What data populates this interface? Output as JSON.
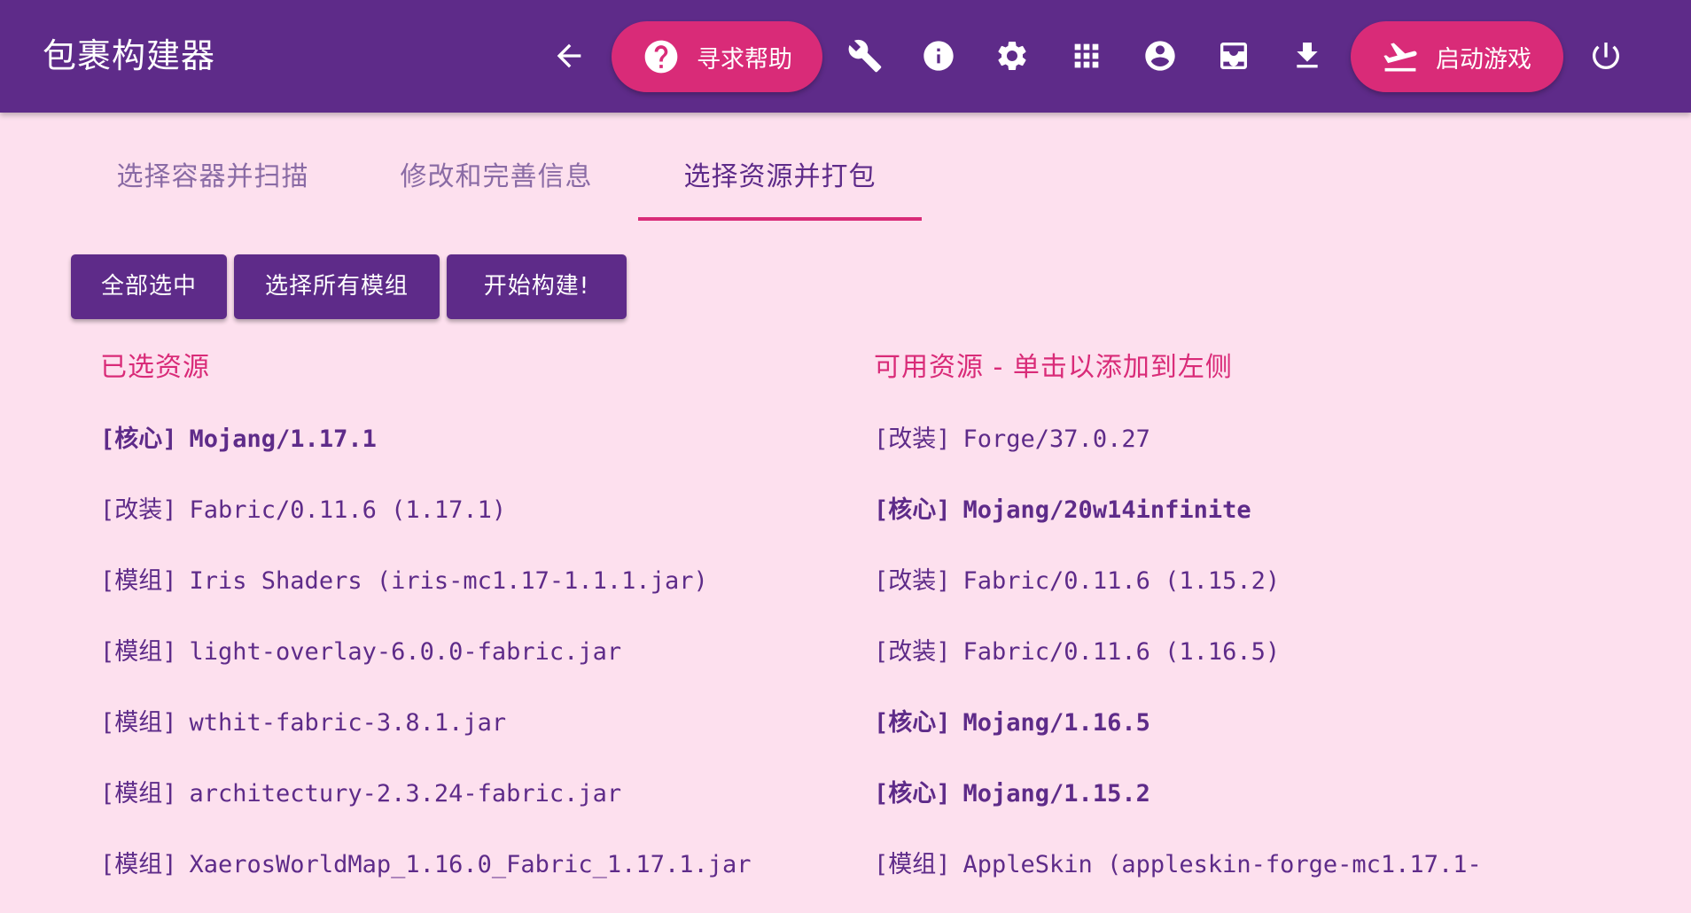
{
  "app": {
    "title": "包裹构建器"
  },
  "toolbar": {
    "help_label": "寻求帮助",
    "launch_label": "启动游戏",
    "icons": [
      "back-arrow-icon",
      "help-icon",
      "wrench-icon",
      "info-icon",
      "settings-gear-icon",
      "apps-grid-icon",
      "account-icon",
      "inbox-tray-icon",
      "download-icon",
      "airplane-takeoff-icon",
      "power-icon"
    ]
  },
  "tabs": [
    {
      "label": "选择容器并扫描",
      "active": false
    },
    {
      "label": "修改和完善信息",
      "active": false
    },
    {
      "label": "选择资源并打包",
      "active": true
    }
  ],
  "actions": {
    "select_all": "全部选中",
    "select_all_mods": "选择所有模组",
    "start_build": "开始构建!"
  },
  "selected": {
    "header": "已选资源",
    "items": [
      {
        "tag": "[核心]",
        "name": "Mojang/1.17.1",
        "bold": true
      },
      {
        "tag": "[改装]",
        "name": "Fabric/0.11.6 (1.17.1)",
        "bold": false
      },
      {
        "tag": "[模组]",
        "name": "Iris Shaders (iris-mc1.17-1.1.1.jar)",
        "bold": false
      },
      {
        "tag": "[模组]",
        "name": "light-overlay-6.0.0-fabric.jar",
        "bold": false
      },
      {
        "tag": "[模组]",
        "name": "wthit-fabric-3.8.1.jar",
        "bold": false
      },
      {
        "tag": "[模组]",
        "name": "architectury-2.3.24-fabric.jar",
        "bold": false
      },
      {
        "tag": "[模组]",
        "name": "XaerosWorldMap_1.16.0_Fabric_1.17.1.jar",
        "bold": false
      }
    ]
  },
  "available": {
    "header": "可用资源 - 单击以添加到左侧",
    "items": [
      {
        "tag": "[改装]",
        "name": "Forge/37.0.27",
        "bold": false
      },
      {
        "tag": "[核心]",
        "name": "Mojang/20w14infinite",
        "bold": true
      },
      {
        "tag": "[改装]",
        "name": "Fabric/0.11.6 (1.15.2)",
        "bold": false
      },
      {
        "tag": "[改装]",
        "name": "Fabric/0.11.6 (1.16.5)",
        "bold": false
      },
      {
        "tag": "[核心]",
        "name": "Mojang/1.16.5",
        "bold": true
      },
      {
        "tag": "[核心]",
        "name": "Mojang/1.15.2",
        "bold": true
      },
      {
        "tag": "[模组]",
        "name": "AppleSkin (appleskin-forge-mc1.17.1-",
        "bold": false
      }
    ]
  },
  "colors": {
    "primary": "#5e2b89",
    "accent": "#d92b78",
    "background": "#fde0ee",
    "tab_inactive": "#8a6ba5"
  }
}
